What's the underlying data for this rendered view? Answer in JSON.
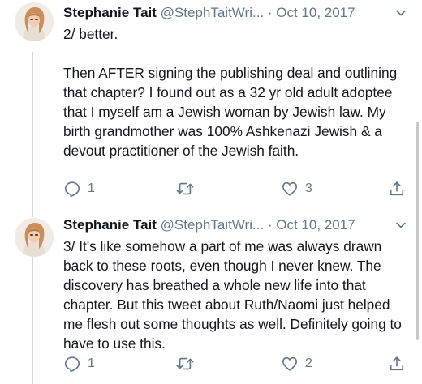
{
  "tweets": [
    {
      "display_name": "Stephanie Tait",
      "handle": "@StephTaitWri...",
      "separator": "·",
      "date": "Oct 10, 2017",
      "paragraphs": [
        "2/ better.",
        "Then AFTER signing the publishing deal and outlining that chapter? I found out as a 32 yr old adult adoptee that I myself am a Jewish woman by Jewish law. My birth grandmother was 100% Ashkenazi Jewish & a devout practitioner of the Jewish faith."
      ],
      "reply_count": "1",
      "retweet_count": "",
      "like_count": "3"
    },
    {
      "display_name": "Stephanie Tait",
      "handle": "@StephTaitWri...",
      "separator": "·",
      "date": "Oct 10, 2017",
      "paragraphs": [
        "3/ It's like somehow a part of me was always drawn back to these roots, even though I never knew. The discovery has breathed a whole new life into that chapter. But this tweet about Ruth/Naomi just helped me flesh out some thoughts as well. Definitely going to have to use this."
      ],
      "reply_count": "1",
      "retweet_count": "",
      "like_count": "2"
    }
  ],
  "icons": {
    "reply": "reply-icon",
    "retweet": "retweet-icon",
    "like": "heart-icon",
    "share": "share-icon",
    "caret": "chevron-down-icon"
  },
  "colors": {
    "text": "#14171a",
    "secondary": "#657786",
    "thread_line": "#cfd9de"
  }
}
